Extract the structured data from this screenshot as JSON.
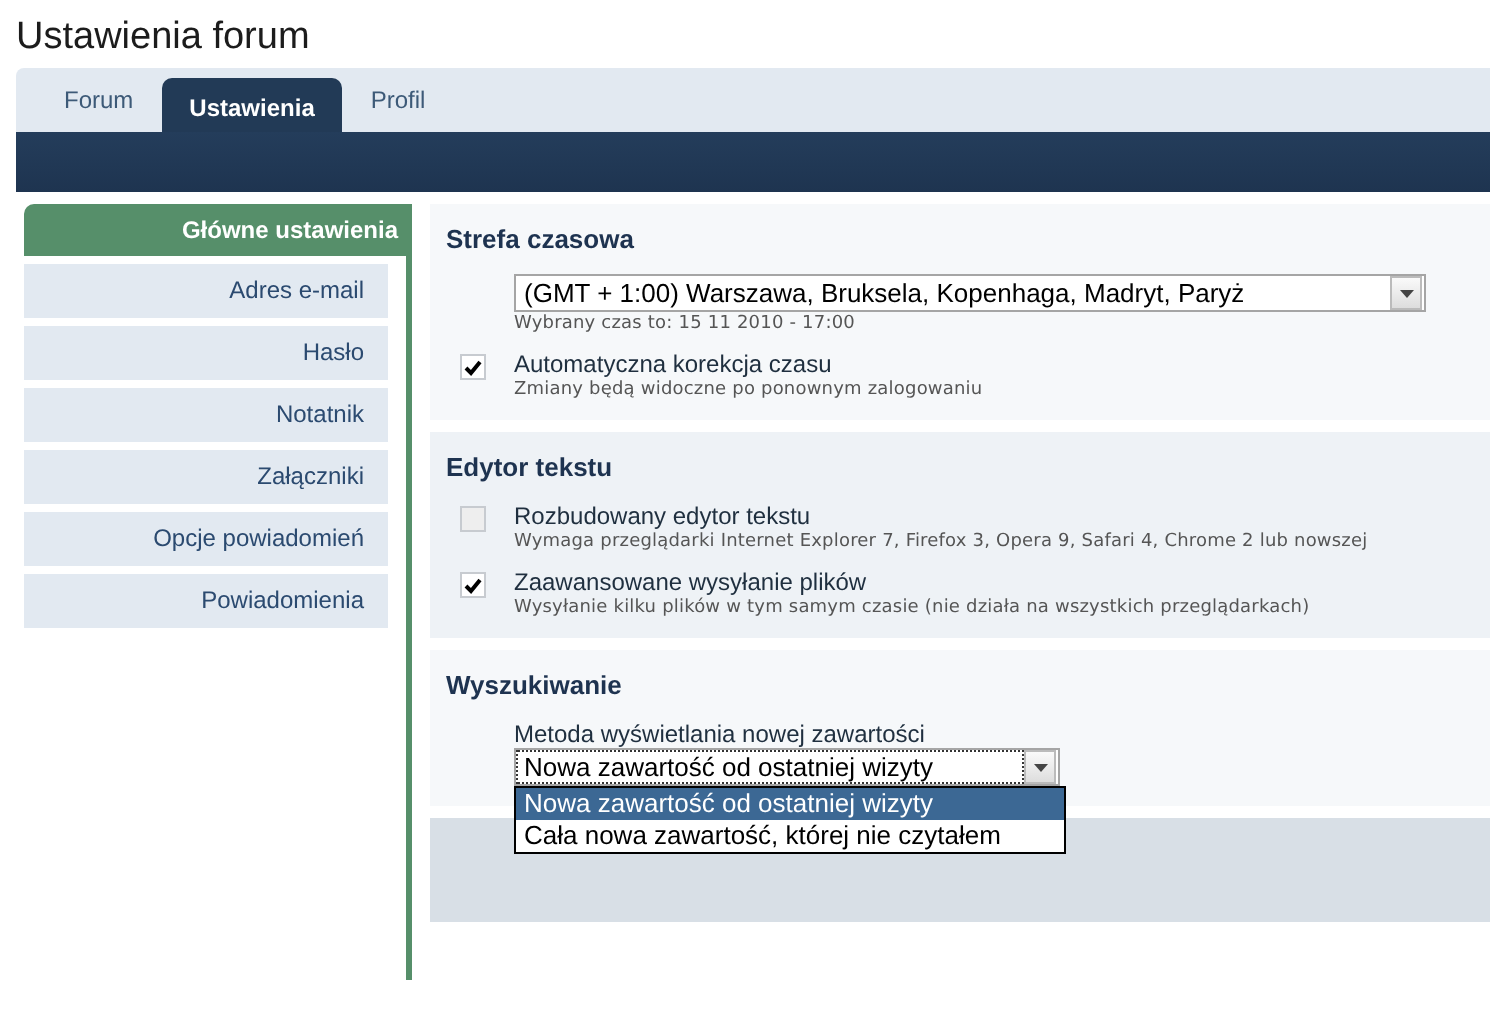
{
  "page_title": "Ustawienia forum",
  "tabs": [
    {
      "label": "Forum",
      "selected": false
    },
    {
      "label": "Ustawienia",
      "selected": true
    },
    {
      "label": "Profil",
      "selected": false
    }
  ],
  "sidebar": {
    "items": [
      {
        "label": "Główne ustawienia",
        "selected": true
      },
      {
        "label": "Adres e-mail",
        "selected": false
      },
      {
        "label": "Hasło",
        "selected": false
      },
      {
        "label": "Notatnik",
        "selected": false
      },
      {
        "label": "Załączniki",
        "selected": false
      },
      {
        "label": "Opcje powiadomień",
        "selected": false
      },
      {
        "label": "Powiadomienia",
        "selected": false
      }
    ]
  },
  "sections": [
    {
      "title": "Strefa czasowa",
      "items": [
        {
          "kind": "select",
          "value": "(GMT + 1:00) Warszawa, Bruksela, Kopenhaga, Madryt, Paryż",
          "note": "Wybrany czas to: 15 11 2010 - 17:00",
          "expanded": false
        },
        {
          "kind": "checkbox",
          "label": "Automatyczna korekcja czasu",
          "note": "Zmiany będą widoczne po ponownym zalogowaniu",
          "checked": true,
          "disabled": false
        }
      ]
    },
    {
      "title": "Edytor tekstu",
      "items": [
        {
          "kind": "checkbox",
          "label": "Rozbudowany edytor tekstu",
          "note": "Wymaga przeglądarki Internet Explorer 7, Firefox 3, Opera 9, Safari 4, Chrome 2 lub nowszej",
          "checked": false,
          "disabled": true
        },
        {
          "kind": "checkbox",
          "label": "Zaawansowane wysyłanie plików",
          "note": "Wysyłanie kilku plików w tym samym czasie (nie działa na wszystkich przeglądarkach)",
          "checked": true,
          "disabled": false
        }
      ]
    },
    {
      "title": "Wyszukiwanie",
      "items": [
        {
          "kind": "select",
          "label": "Metoda wyświetlania nowej zawartości",
          "value": "Nowa zawartość od ostatniej wizyty",
          "expanded": true,
          "options": [
            {
              "label": "Nowa zawartość od ostatniej wizyty",
              "selected": true
            },
            {
              "label": "Cała nowa zawartość, której nie czytałem",
              "selected": false
            }
          ]
        }
      ]
    }
  ]
}
